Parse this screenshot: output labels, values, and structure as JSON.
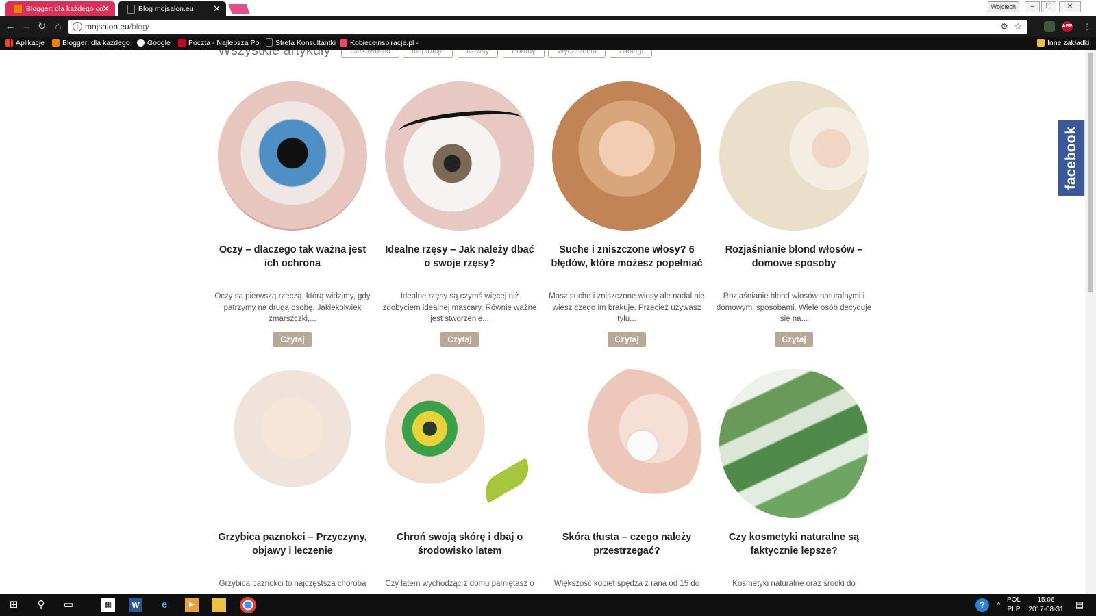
{
  "browser": {
    "tabs": [
      {
        "title": "Blogger: dla każdego co",
        "active": false
      },
      {
        "title": "Blog mojsalon.eu",
        "active": true
      }
    ],
    "user_badge": "Wojciech",
    "url_host": "mojsalon.eu",
    "url_path": "/blog/",
    "bookmarks": [
      {
        "label": "Aplikacje",
        "icon": "apps-grid-icon"
      },
      {
        "label": "Blogger: dla każdego",
        "icon": "blogger-icon"
      },
      {
        "label": "Google",
        "icon": "google-icon"
      },
      {
        "label": "Poczta - Najlepsza Po",
        "icon": "wp-icon"
      },
      {
        "label": "Strefa Konsultantki",
        "icon": "page-icon"
      },
      {
        "label": "Kobieceinspiracje.pl -",
        "icon": "site-icon"
      }
    ],
    "other_bookmarks": "Inne zakładki",
    "extension_abp": "ABP"
  },
  "page": {
    "heading": "Wszystkie artykuły",
    "filters": [
      "Ciekawostki",
      "Inspiracje",
      "Newsy",
      "Porady",
      "Wydarzenia",
      "Zabiegi"
    ],
    "read_label": "Czytaj",
    "articles": [
      {
        "title": "Oczy – dlaczego tak ważna jest ich ochrona",
        "excerpt": "Oczy są pierwszą rzeczą, którą widzimy, gdy patrzymy na drugą osobę. Jakiekolwiek zmarszczki,...",
        "thumb": "eye"
      },
      {
        "title": "Idealne rzęsy – Jak należy dbać o swoje rzęsy?",
        "excerpt": "Idealne rzęsy są czymś więcej niż zdobyciem idealnej mascary. Równie ważne jest stworzenie...",
        "thumb": "lash"
      },
      {
        "title": "Suche i zniszczone włosy? 6 błędów, które możesz popełniać",
        "excerpt": "Masz suche i zniszczone włosy ale nadal nie wiesz czego im brakuje. Przecież używasz tylu...",
        "thumb": "hair"
      },
      {
        "title": "Rozjaśnianie blond włosów – domowe sposoby",
        "excerpt": "Rozjaśnianie blond włosów naturalnymi i domowymi sposobami. Wiele osób decyduje się na...",
        "thumb": "blond"
      },
      {
        "title": "Grzybica paznokci – Przyczyny, objawy i leczenie",
        "excerpt": "Grzybica paznokci to najczęstsza choroba",
        "thumb": "foot"
      },
      {
        "title": "Chroń swoją skórę i dbaj o środowisko latem",
        "excerpt": "Czy latem wychodząc z domu pamiętasz o",
        "thumb": "makeup"
      },
      {
        "title": "Skóra tłusta – czego należy przestrzegać?",
        "excerpt": "Większość kobiet spędza z rana od 15 do",
        "thumb": "skin"
      },
      {
        "title": "Czy kosmetyki naturalne są faktycznie lepsze?",
        "excerpt": "Kosmetyki naturalne oraz środki do",
        "thumb": "aloe"
      }
    ],
    "facebook_label": "facebook"
  },
  "taskbar": {
    "lang": "POL",
    "layout": "PLP",
    "time": "15:06",
    "date": "2017-08-31"
  },
  "colors": {
    "tab_active_bg": "#1a1a1a",
    "tab_inactive_bg": "#d9325a",
    "button_bg": "#b8a898",
    "facebook_bg": "#3b5998"
  }
}
